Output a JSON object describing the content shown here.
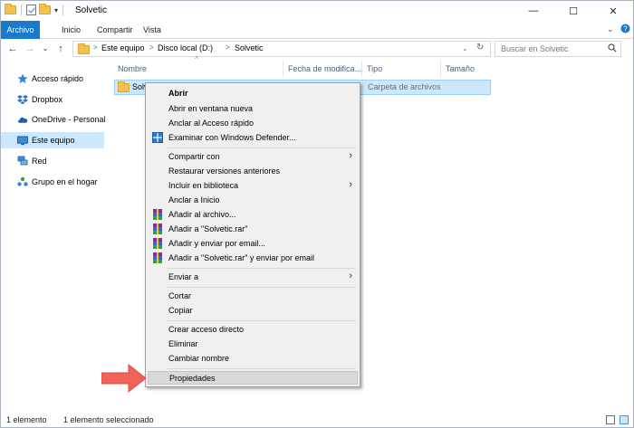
{
  "window": {
    "title": "Solvetic",
    "controls": {
      "minimize": "—",
      "maximize": "☐",
      "close": "✕"
    }
  },
  "ribbon": {
    "tabs": [
      "Archivo",
      "Inicio",
      "Compartir",
      "Vista"
    ]
  },
  "address": {
    "crumbs": [
      "Este equipo",
      "Disco local (D:)",
      "Solvetic"
    ],
    "search_placeholder": "Buscar en Solvetic"
  },
  "sidebar": {
    "items": [
      {
        "label": "Acceso rápido",
        "icon": "star-icon"
      },
      {
        "label": "Dropbox",
        "icon": "dropbox-icon"
      },
      {
        "label": "OneDrive - Personal",
        "icon": "cloud-icon"
      },
      {
        "label": "Este equipo",
        "icon": "computer-icon",
        "selected": true
      },
      {
        "label": "Red",
        "icon": "network-icon"
      },
      {
        "label": "Grupo en el hogar",
        "icon": "homegroup-icon"
      }
    ]
  },
  "list": {
    "columns": [
      "Nombre",
      "Fecha de modifica...",
      "Tipo",
      "Tamaño"
    ],
    "rows": [
      {
        "name": "Solv",
        "date": "",
        "type": "Carpeta de archivos",
        "size": ""
      }
    ]
  },
  "context_menu": {
    "items": [
      {
        "label": "Abrir",
        "bold": true
      },
      {
        "label": "Abrir en ventana nueva"
      },
      {
        "label": "Anclar al Acceso rápido"
      },
      {
        "label": "Examinar con Windows Defender...",
        "icon": "defender-icon"
      },
      {
        "label": "Compartir con",
        "submenu": true
      },
      {
        "label": "Restaurar versiones anteriores"
      },
      {
        "label": "Incluir en biblioteca",
        "submenu": true
      },
      {
        "label": "Anclar a Inicio"
      },
      {
        "label": "Añadir al archivo...",
        "icon": "winrar-icon"
      },
      {
        "label": "Añadir a \"Solvetic.rar\"",
        "icon": "winrar-icon"
      },
      {
        "label": "Añadir y enviar por email...",
        "icon": "winrar-icon"
      },
      {
        "label": "Añadir a \"Solvetic.rar\" y enviar por email",
        "icon": "winrar-icon"
      },
      {
        "label": "Enviar a",
        "submenu": true
      },
      {
        "label": "Cortar"
      },
      {
        "label": "Copiar"
      },
      {
        "label": "Crear acceso directo"
      },
      {
        "label": "Eliminar"
      },
      {
        "label": "Cambiar nombre"
      },
      {
        "label": "Propiedades",
        "highlighted": true
      }
    ]
  },
  "status": {
    "count": "1 elemento",
    "selection": "1 elemento seleccionado"
  },
  "colors": {
    "accent": "#1979ca",
    "selection": "#cce8ff",
    "arrow": "#f0635a"
  }
}
